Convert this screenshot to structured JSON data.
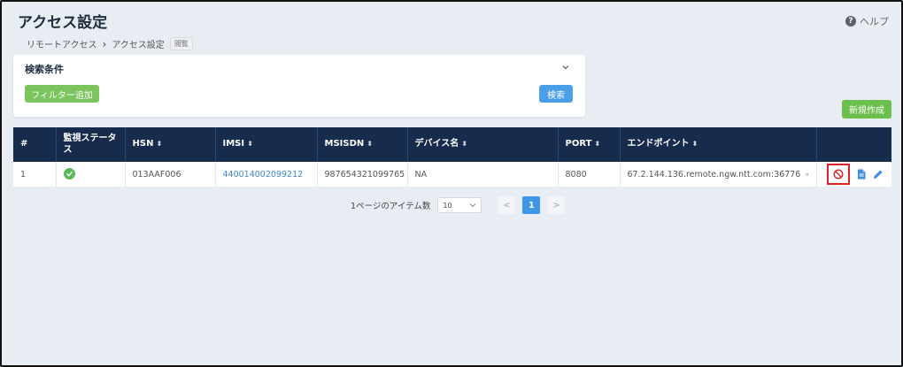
{
  "header": {
    "title": "アクセス設定",
    "help_label": "ヘルプ"
  },
  "breadcrumb": {
    "items": [
      "リモートアクセス",
      "アクセス設定"
    ],
    "tag": "閲覧"
  },
  "search_panel": {
    "title": "検索条件",
    "filter_button": "フィルター追加",
    "search_button": "検索"
  },
  "toolbar": {
    "create_button": "新規作成"
  },
  "table": {
    "columns": [
      "#",
      "監視ステータス",
      "HSN",
      "IMSI",
      "MSISDN",
      "デバイス名",
      "PORT",
      "エンドポイント"
    ],
    "rows": [
      {
        "index": "1",
        "status": "ok",
        "hsn": "013AAF006",
        "imsi": "440014002099212",
        "msisdn": "987654321099765",
        "device_name": "NA",
        "port": "8080",
        "endpoint": "67.2.144.136.remote.ngw.ntt.com:36776"
      }
    ]
  },
  "pagination": {
    "items_per_page_label": "1ページのアイテム数",
    "page_size": "10",
    "prev": "<",
    "current_page": "1",
    "next": ">"
  },
  "colors": {
    "header_bg": "#172b4d",
    "accent_blue": "#4a9fe8",
    "accent_green": "#6bbf4c",
    "highlight_red": "#d9232a"
  }
}
